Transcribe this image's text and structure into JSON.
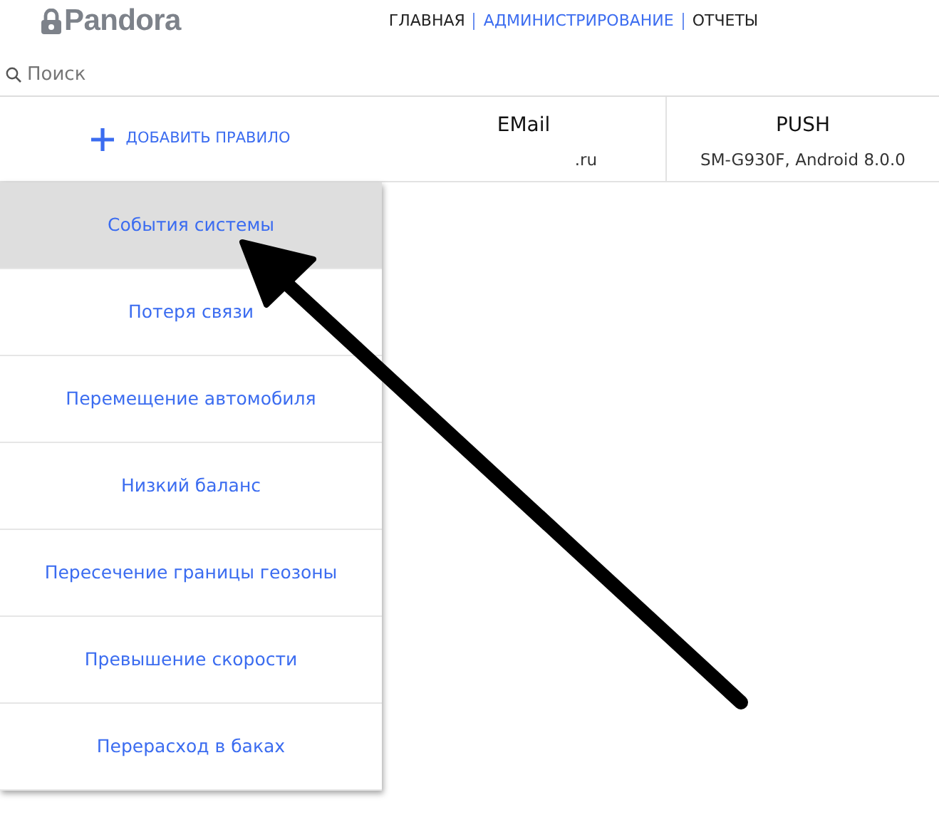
{
  "logo": {
    "text": "Pandora"
  },
  "nav": [
    {
      "label": "ГЛАВНАЯ",
      "selected": false
    },
    {
      "label": "АДМИНИСТРИРОВАНИЕ",
      "selected": true
    },
    {
      "label": "ОТЧЕТЫ",
      "selected": false
    }
  ],
  "search": {
    "placeholder": "Поиск"
  },
  "add_rule": {
    "label": "ДОБАВИТЬ ПРАВИЛО"
  },
  "channels": [
    {
      "title": "EMail",
      "detail": ".ru"
    },
    {
      "title": "PUSH",
      "detail": "SM-G930F, Android 8.0.0"
    }
  ],
  "rules": [
    {
      "label": "События системы",
      "selected": true
    },
    {
      "label": "Потеря связи",
      "selected": false
    },
    {
      "label": "Перемещение автомобиля",
      "selected": false
    },
    {
      "label": "Низкий баланс",
      "selected": false
    },
    {
      "label": "Пересечение границы геозоны",
      "selected": false
    },
    {
      "label": "Превышение скорости",
      "selected": false
    },
    {
      "label": "Перерасход в баках",
      "selected": false
    }
  ]
}
